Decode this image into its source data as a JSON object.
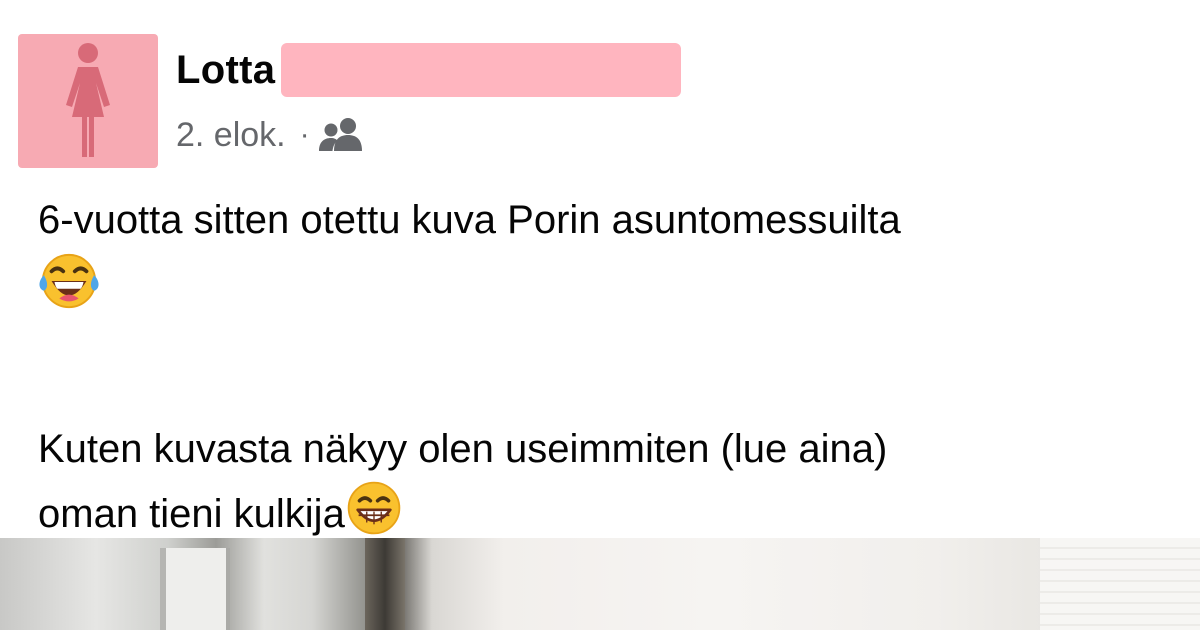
{
  "author": {
    "first_name": "Lotta",
    "avatar_icon": "female-silhouette-icon",
    "avatar_bg": "#f7aab3",
    "redaction_color": "#ffb5bf"
  },
  "meta": {
    "date": "2. elok.",
    "separator": "·",
    "audience_icon": "friends-icon"
  },
  "post": {
    "line1": "6-vuotta sitten otettu kuva Porin asuntomessuilta",
    "line1_emoji": "face-with-tears-of-joy-icon",
    "line2": "Kuten kuvasta näkyy olen useimmiten (lue aina)",
    "line3": "oman tieni kulkija",
    "line3_emoji": "grinning-face-with-smiling-eyes-icon"
  },
  "attachment": {
    "type": "photo"
  }
}
